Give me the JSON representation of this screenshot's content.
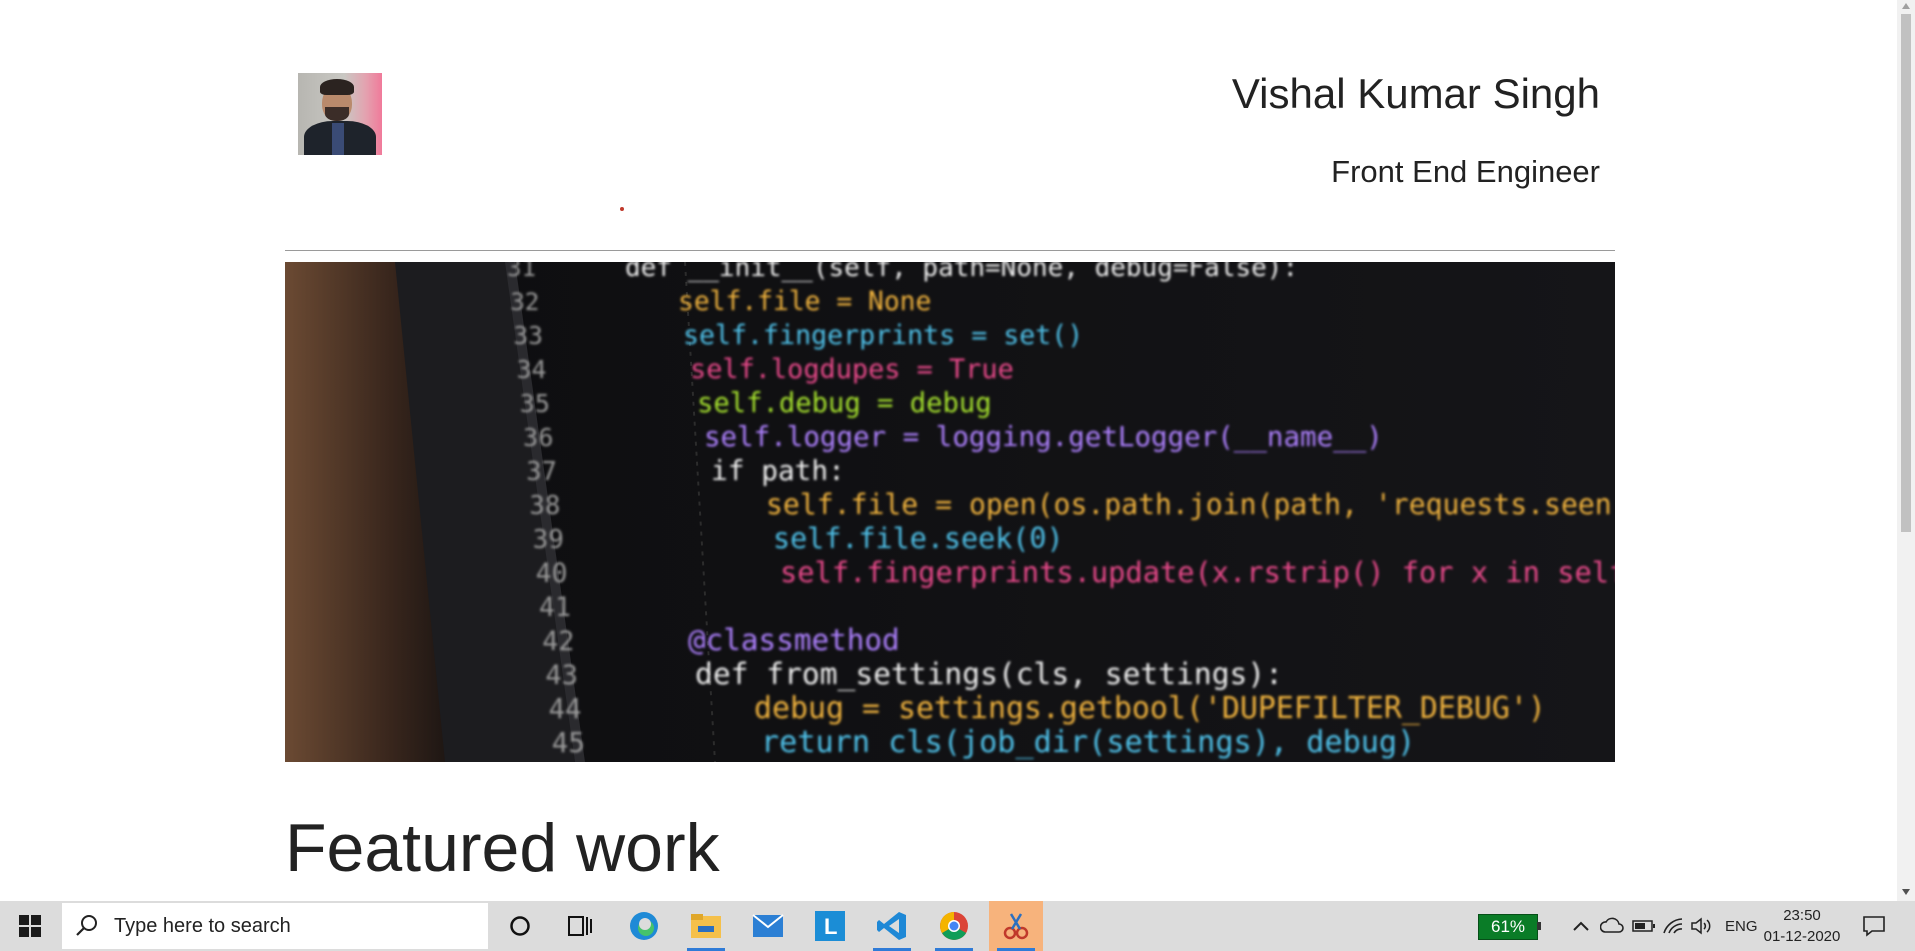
{
  "header": {
    "name": "Vishal Kumar Singh",
    "role": "Front End Engineer"
  },
  "hero": {
    "code_lines": [
      {
        "num": "31",
        "code": "def __init__(self, path=None, debug=False):"
      },
      {
        "num": "32",
        "code": "self.file = None"
      },
      {
        "num": "33",
        "code": "self.fingerprints = set()"
      },
      {
        "num": "34",
        "code": "self.logdupes = True"
      },
      {
        "num": "35",
        "code": "self.debug = debug"
      },
      {
        "num": "36",
        "code": "self.logger = logging.getLogger(__name__)"
      },
      {
        "num": "37",
        "code": "if path:"
      },
      {
        "num": "38",
        "code": "self.file = open(os.path.join(path, 'requests.seen'), 'a+')"
      },
      {
        "num": "39",
        "code": "self.file.seek(0)"
      },
      {
        "num": "40",
        "code": "self.fingerprints.update(x.rstrip() for x in self.file)"
      },
      {
        "num": "41",
        "code": ""
      },
      {
        "num": "42",
        "code": "@classmethod"
      },
      {
        "num": "43",
        "code": "def from_settings(cls, settings):"
      },
      {
        "num": "44",
        "code": "debug = settings.getbool('DUPEFILTER_DEBUG')"
      },
      {
        "num": "45",
        "code": "return cls(job_dir(settings), debug)"
      }
    ]
  },
  "sections": {
    "featured_title": "Featured work"
  },
  "taskbar": {
    "search_placeholder": "Type here to search",
    "battery": "61%",
    "language": "ENG",
    "time": "23:50",
    "date": "01-12-2020",
    "apps": [
      "edge-icon",
      "file-explorer-icon",
      "mail-icon",
      "l-app-icon",
      "vscode-icon",
      "chrome-icon",
      "snipping-tool-icon"
    ]
  }
}
